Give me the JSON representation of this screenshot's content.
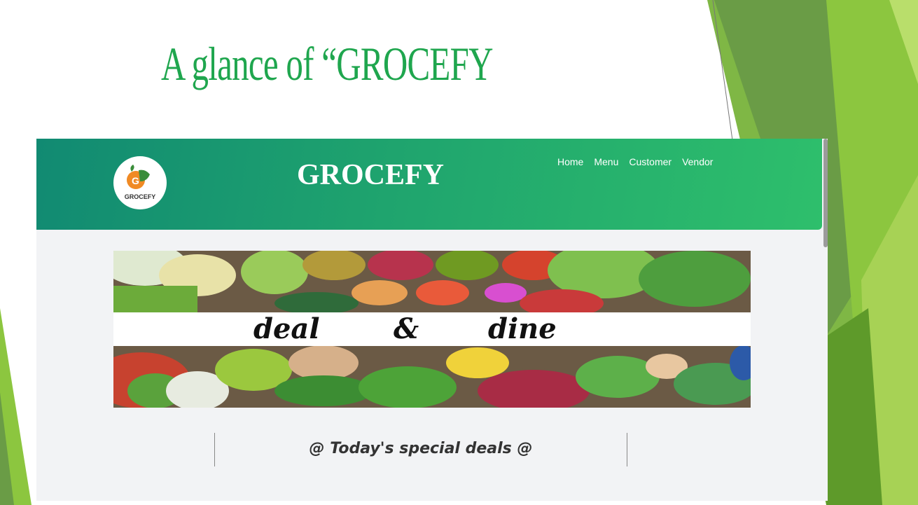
{
  "slide": {
    "title": "A glance of “GROCEFY",
    "colors": {
      "title": "#1fa64e",
      "accent_light": "#8dc63f",
      "accent_dark": "#5a9b2f"
    }
  },
  "site": {
    "logo_text": "GROCEFY",
    "brand": "GROCEFY",
    "nav": [
      {
        "label": "Home"
      },
      {
        "label": "Menu"
      },
      {
        "label": "Customer"
      },
      {
        "label": "Vendor"
      }
    ],
    "banner": {
      "word_left": "deal",
      "word_mid": "&",
      "word_right": "dine"
    },
    "deals_heading": "@ Today's special deals @",
    "colors": {
      "header_start": "#118a72",
      "header_end": "#2ebf6c",
      "page_bg": "#f2f3f5"
    }
  }
}
